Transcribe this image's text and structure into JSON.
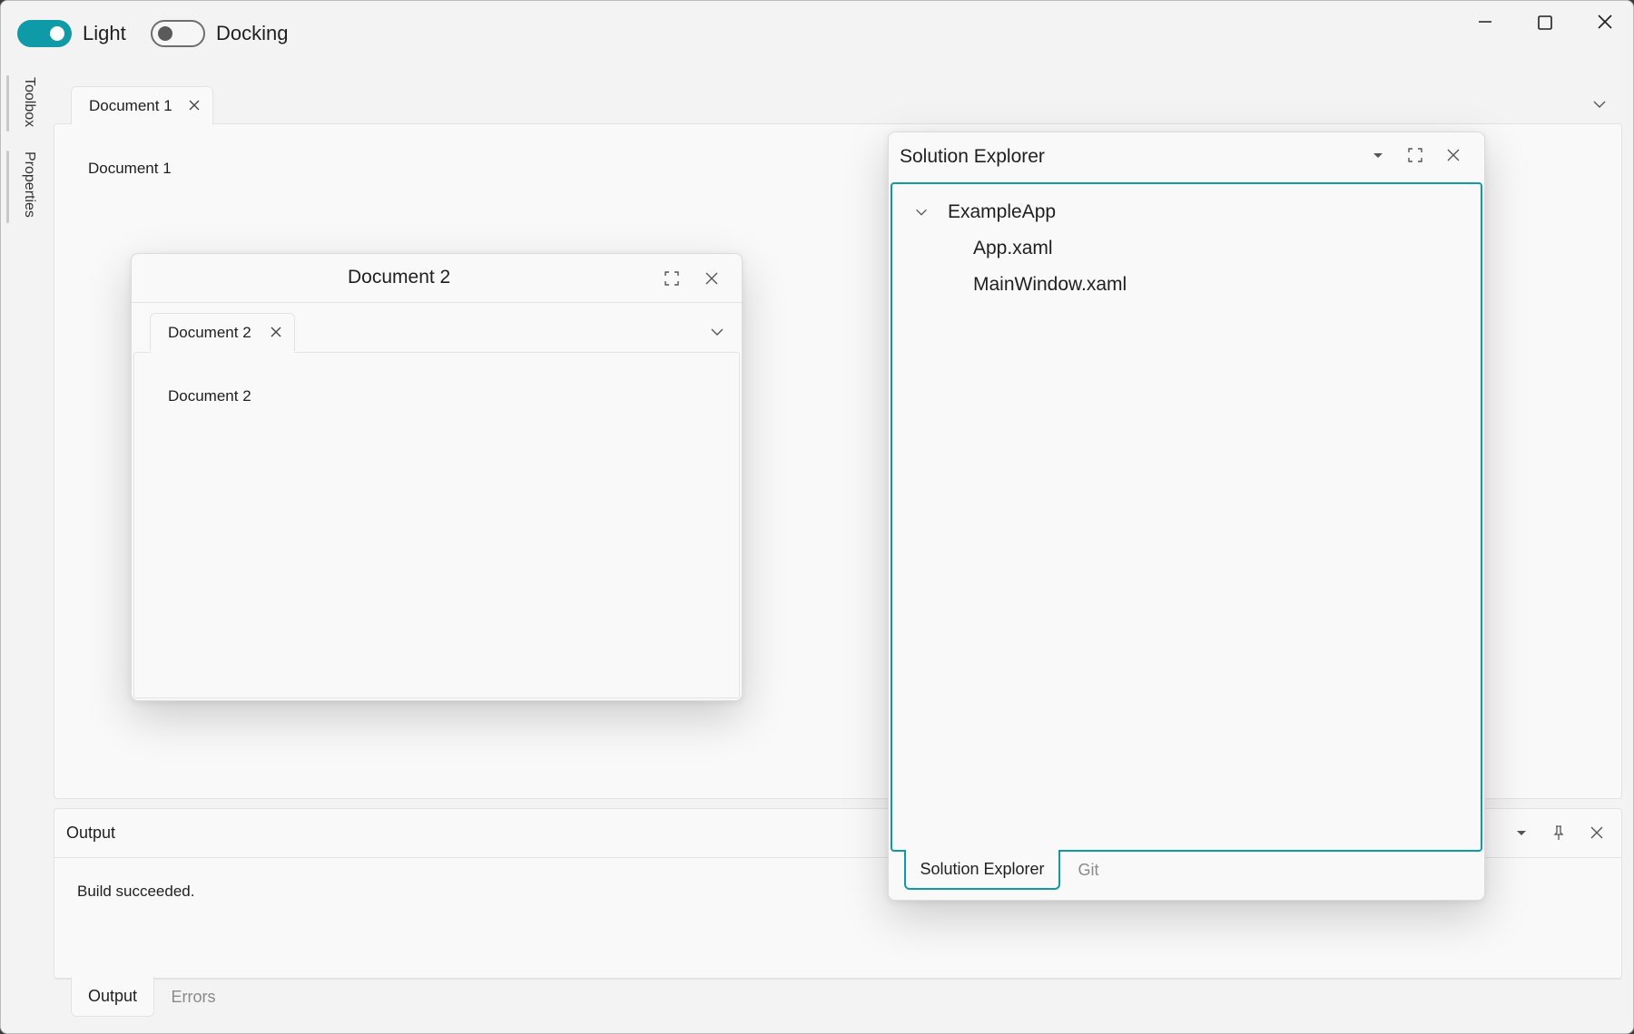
{
  "topbar": {
    "theme_toggle_label": "Light",
    "docking_toggle_label": "Docking"
  },
  "sidebar": {
    "items": [
      {
        "label": "Toolbox"
      },
      {
        "label": "Properties"
      }
    ]
  },
  "documents": {
    "tab1_label": "Document 1",
    "content1": "Document 1"
  },
  "floating_document": {
    "title": "Document 2",
    "tab_label": "Document 2",
    "content": "Document 2"
  },
  "solution_explorer": {
    "title": "Solution Explorer",
    "tree": {
      "root": "ExampleApp",
      "children": [
        "App.xaml",
        "MainWindow.xaml"
      ]
    },
    "tabs": [
      "Solution Explorer",
      "Git"
    ]
  },
  "output_panel": {
    "title": "Output",
    "message": "Build succeeded.",
    "tabs": [
      "Output",
      "Errors"
    ]
  },
  "colors": {
    "accent": "#0f9aa8",
    "window_bg": "#f3f3f3",
    "panel_bg": "#f9f9f9"
  }
}
